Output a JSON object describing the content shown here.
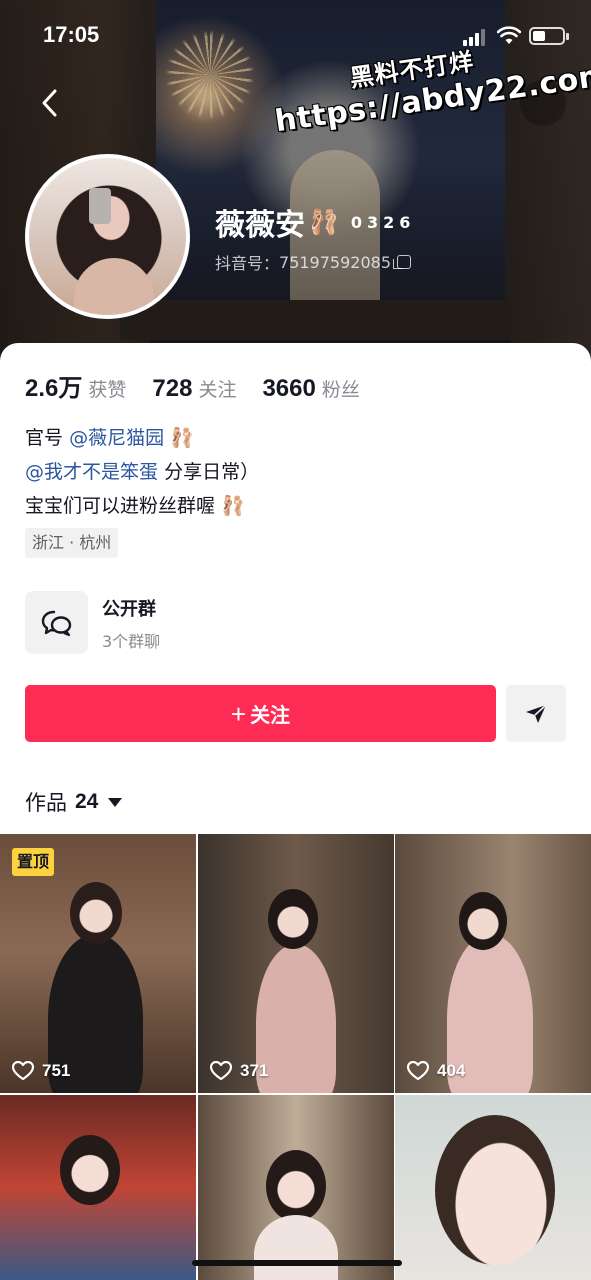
{
  "status_bar": {
    "time": "17:05"
  },
  "watermark": {
    "line1": "黑料不打烊",
    "line2": "https://abdy22.com"
  },
  "profile": {
    "name": "薇薇安",
    "name_emoji": "🩰",
    "name_tag": "0326",
    "douyin_id_label": "抖音号：",
    "douyin_id": "75197592085"
  },
  "stats": [
    {
      "value": "2.6万",
      "label": "获赞"
    },
    {
      "value": "728",
      "label": "关注"
    },
    {
      "value": "3660",
      "label": "粉丝"
    }
  ],
  "bio": {
    "line1_prefix": "官号",
    "line1_mention": "@薇尼猫园",
    "line1_emoji": "🩰",
    "line2_mention": "@我才不是笨蛋",
    "line2_suffix": " 分享日常）",
    "line3_text": "宝宝们可以进粉丝群喔",
    "line3_emoji": "🩰"
  },
  "location": "浙江 · 杭州",
  "group": {
    "title": "公开群",
    "subtitle": "3个群聊"
  },
  "actions": {
    "follow_label": "关注",
    "follow_plus": "+"
  },
  "works": {
    "label": "作品",
    "count": "24"
  },
  "videos": [
    {
      "likes": "751",
      "pinned": true,
      "pin_label": "置顶"
    },
    {
      "likes": "371",
      "pinned": false
    },
    {
      "likes": "404",
      "pinned": false
    },
    {
      "likes": "",
      "pinned": false
    },
    {
      "likes": "",
      "pinned": false
    },
    {
      "likes": "",
      "pinned": false
    }
  ],
  "colors": {
    "accent": "#fe2c55",
    "mention": "#2c57a0",
    "pin": "#fdd33d"
  }
}
